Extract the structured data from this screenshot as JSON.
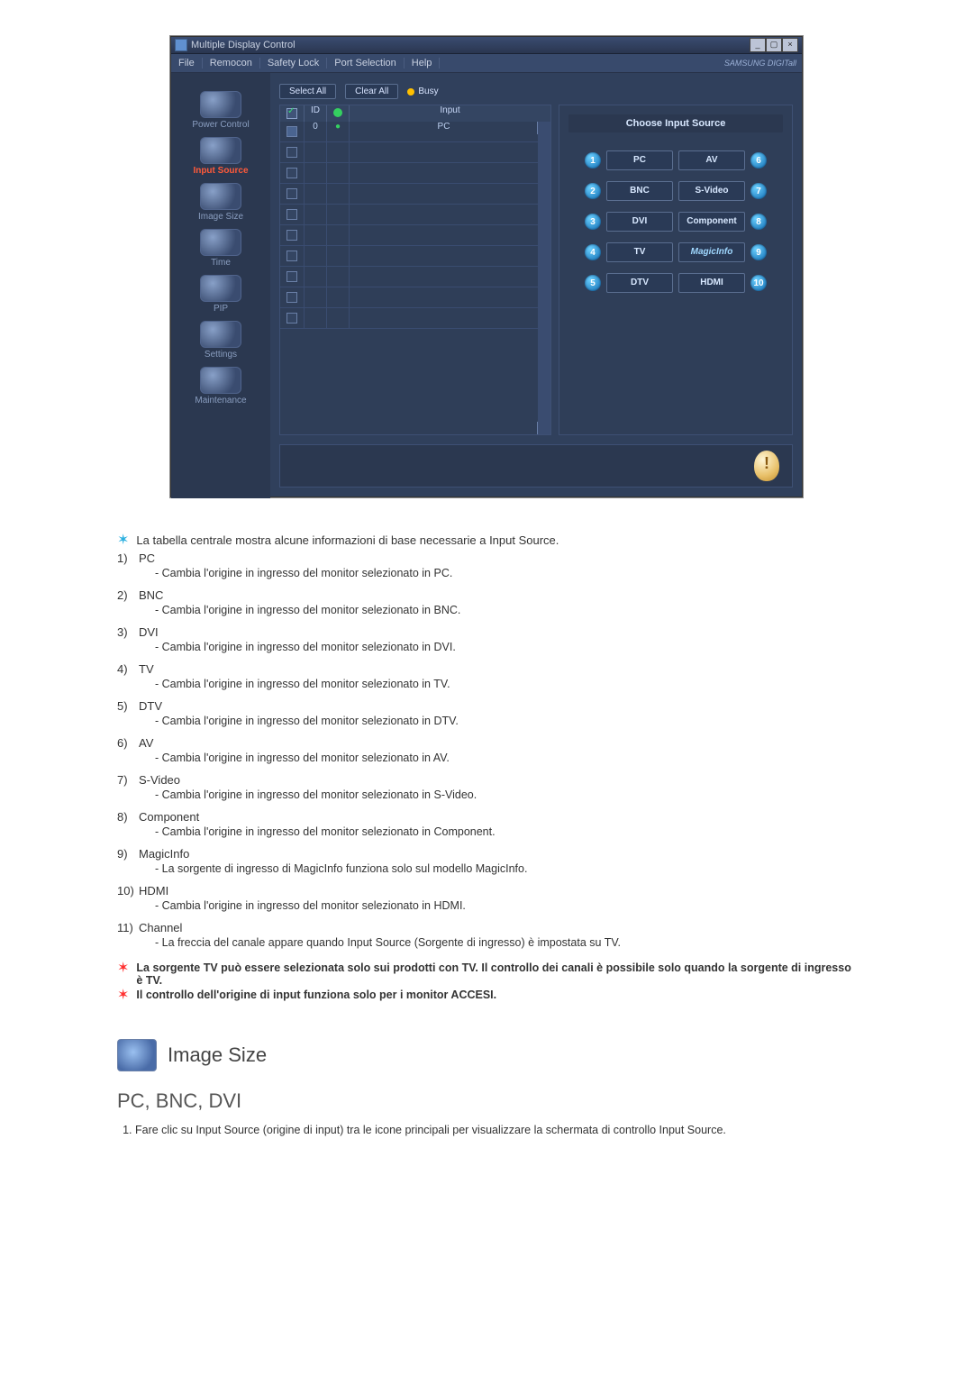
{
  "window": {
    "title": "Multiple Display Control",
    "menus": [
      "File",
      "Remocon",
      "Safety Lock",
      "Port Selection",
      "Help"
    ],
    "brand": "SAMSUNG DIGITall"
  },
  "sidebar": {
    "items": [
      {
        "label": "Power Control",
        "name": "power-control"
      },
      {
        "label": "Input Source",
        "name": "input-source",
        "active": true
      },
      {
        "label": "Image Size",
        "name": "image-size"
      },
      {
        "label": "Time",
        "name": "time"
      },
      {
        "label": "PIP",
        "name": "pip"
      },
      {
        "label": "Settings",
        "name": "settings"
      },
      {
        "label": "Maintenance",
        "name": "maintenance"
      }
    ]
  },
  "toolbar": {
    "select_all": "Select All",
    "clear_all": "Clear All",
    "busy": "Busy"
  },
  "grid": {
    "head_id": "ID",
    "head_input": "Input",
    "rows": [
      {
        "id": "0",
        "val": "PC",
        "checked": true,
        "status": true
      },
      {
        "id": "",
        "val": ""
      },
      {
        "id": "",
        "val": ""
      },
      {
        "id": "",
        "val": ""
      },
      {
        "id": "",
        "val": ""
      },
      {
        "id": "",
        "val": ""
      },
      {
        "id": "",
        "val": ""
      },
      {
        "id": "",
        "val": ""
      },
      {
        "id": "",
        "val": ""
      },
      {
        "id": "",
        "val": ""
      }
    ]
  },
  "panel": {
    "title": "Choose Input Source",
    "left": [
      {
        "n": "1",
        "label": "PC"
      },
      {
        "n": "2",
        "label": "BNC"
      },
      {
        "n": "3",
        "label": "DVI"
      },
      {
        "n": "4",
        "label": "TV"
      },
      {
        "n": "5",
        "label": "DTV"
      }
    ],
    "right": [
      {
        "n": "6",
        "label": "AV"
      },
      {
        "n": "7",
        "label": "S-Video"
      },
      {
        "n": "8",
        "label": "Component"
      },
      {
        "n": "9",
        "label": "MagicInfo"
      },
      {
        "n": "10",
        "label": "HDMI"
      }
    ]
  },
  "doc": {
    "intro": "La tabella centrale mostra alcune informazioni di base necessarie a Input Source.",
    "items": [
      {
        "n": "1)",
        "term": "PC",
        "desc": "- Cambia l'origine in ingresso del monitor selezionato in PC."
      },
      {
        "n": "2)",
        "term": "BNC",
        "desc": "- Cambia l'origine in ingresso del monitor selezionato in BNC."
      },
      {
        "n": "3)",
        "term": "DVI",
        "desc": "- Cambia l'origine in ingresso del monitor selezionato in DVI."
      },
      {
        "n": "4)",
        "term": "TV",
        "desc": "- Cambia l'origine in ingresso del monitor selezionato in TV."
      },
      {
        "n": "5)",
        "term": "DTV",
        "desc": "- Cambia l'origine in ingresso del monitor selezionato in DTV."
      },
      {
        "n": "6)",
        "term": "AV",
        "desc": "- Cambia l'origine in ingresso del monitor selezionato in AV."
      },
      {
        "n": "7)",
        "term": "S-Video",
        "desc": "- Cambia l'origine in ingresso del monitor selezionato in S-Video."
      },
      {
        "n": "8)",
        "term": "Component",
        "desc": "- Cambia l'origine in ingresso del monitor selezionato in Component."
      },
      {
        "n": "9)",
        "term": "MagicInfo",
        "desc": "- La sorgente di ingresso di MagicInfo funziona solo sul modello MagicInfo."
      },
      {
        "n": "10)",
        "term": "HDMI",
        "desc": "- Cambia l'origine in ingresso del monitor selezionato in HDMI."
      },
      {
        "n": "11)",
        "term": "Channel",
        "desc": "- La freccia del canale appare quando Input Source (Sorgente di ingresso) è impostata su TV."
      }
    ],
    "warn1": "La sorgente TV può essere selezionata solo sui prodotti con TV. Il controllo dei canali è possibile solo quando la sorgente di ingresso è TV.",
    "warn2": "Il controllo dell'origine di input funziona solo per i monitor ACCESI.",
    "section_title": "Image Size",
    "subsection": "PC, BNC, DVI",
    "step1": "Fare clic su Input Source (origine di input) tra le icone principali per visualizzare la schermata di controllo Input Source."
  }
}
